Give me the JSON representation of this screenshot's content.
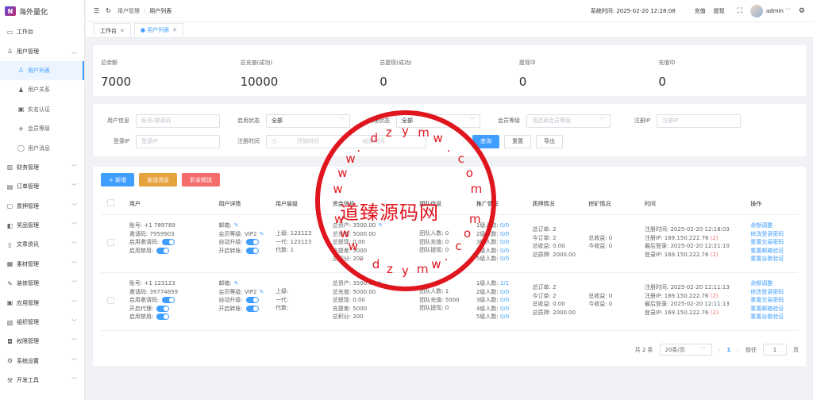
{
  "app": {
    "name": "海外量化"
  },
  "sidebar": {
    "items": [
      {
        "label": "工作台",
        "icon": "monitor-icon",
        "arrow": ""
      },
      {
        "label": "用户管理",
        "icon": "user-icon",
        "arrow": "︿"
      },
      {
        "label": "财务管理",
        "icon": "chart-icon",
        "arrow": "﹀"
      },
      {
        "label": "订单管理",
        "icon": "order-icon",
        "arrow": "﹀"
      },
      {
        "label": "质押管理",
        "icon": "wallet-icon",
        "arrow": "﹀"
      },
      {
        "label": "奖品管理",
        "icon": "gift-icon",
        "arrow": "﹀"
      },
      {
        "label": "文章资讯",
        "icon": "doc-icon",
        "arrow": "﹀"
      },
      {
        "label": "素材管理",
        "icon": "picture-icon",
        "arrow": "﹀"
      },
      {
        "label": "装修管理",
        "icon": "brush-icon",
        "arrow": "﹀"
      },
      {
        "label": "应用管理",
        "icon": "app-icon",
        "arrow": "﹀"
      },
      {
        "label": "组织管理",
        "icon": "org-icon",
        "arrow": "﹀"
      },
      {
        "label": "权限管理",
        "icon": "lock-icon",
        "arrow": "﹀"
      },
      {
        "label": "系统设置",
        "icon": "gear-icon",
        "arrow": "﹀"
      },
      {
        "label": "开发工具",
        "icon": "tool-icon",
        "arrow": "﹀"
      }
    ],
    "user_submenu": [
      {
        "label": "用户列表",
        "icon": "user-icon"
      },
      {
        "label": "用户关系",
        "icon": "users-icon"
      },
      {
        "label": "实名认证",
        "icon": "id-card-icon"
      },
      {
        "label": "会员等级",
        "icon": "rocket-icon"
      },
      {
        "label": "用户消息",
        "icon": "message-icon"
      }
    ]
  },
  "topbar": {
    "breadcrumb": [
      "用户管理",
      "用户列表"
    ],
    "system_time_label": "系统时间:",
    "system_time": "2025-02-20 12:28:08",
    "recharge": "充值",
    "withdraw": "提现",
    "user": "admin"
  },
  "tabs": [
    {
      "label": "工作台"
    },
    {
      "label": "● 用户列表"
    }
  ],
  "stats": [
    {
      "label": "总余额",
      "value": "7000"
    },
    {
      "label": "总充值(成功)",
      "value": "10000"
    },
    {
      "label": "总提现(成功)",
      "value": "0"
    },
    {
      "label": "提现中",
      "value": "0"
    },
    {
      "label": "充值中",
      "value": "0"
    }
  ],
  "filters": {
    "user_info": {
      "label": "用户信息",
      "placeholder": "账号/邀请码"
    },
    "status": {
      "label": "启用状态",
      "value": "全部"
    },
    "agent": {
      "label": "代理状态",
      "value": "全部"
    },
    "member_level": {
      "label": "会员等级",
      "placeholder": "请选择会员等级"
    },
    "reg_ip": {
      "label": "注册IP",
      "placeholder": "注册IP"
    },
    "login_ip": {
      "label": "登录IP",
      "placeholder": "登录IP"
    },
    "reg_time": {
      "label": "注册时间",
      "start": "开始时间",
      "sep": "-",
      "end": "结束时间"
    },
    "query": "查询",
    "reset": "重置",
    "export": "导出"
  },
  "actions": {
    "add": "+ 新增",
    "send": "发送消息",
    "gift": "彩金赠送"
  },
  "table": {
    "headers": [
      "用户",
      "用户详情",
      "用户层级",
      "资金信息",
      "团队信息",
      "推广情况",
      "质押情况",
      "挖矿情况",
      "时间",
      "操作"
    ],
    "rows": [
      {
        "user": [
          "账号: +1 789789",
          "邀请码: 7959903",
          "启用邀请码:",
          "启用禁用:"
        ],
        "detail": [
          "邮箱:",
          "会员等级: VIP2",
          "自动升级:",
          "开启转账:"
        ],
        "level": [
          "上级: 123123",
          "一代: 123123",
          "代数: 1"
        ],
        "funds": [
          "总资产: 3500.00",
          "总充值: 5000.00",
          "总提现: 0.00",
          "充提差: 5000",
          "总积分: 200"
        ],
        "team": [
          "团队人数: 0",
          "团队充值: 0",
          "团队提现: 0"
        ],
        "promo": [
          [
            "1级人数:",
            "0/0"
          ],
          [
            "2级人数:",
            "0/0"
          ],
          [
            "3级人数:",
            "0/0"
          ],
          [
            "4级人数:",
            "0/0"
          ],
          [
            "5级人数:",
            "0/0"
          ]
        ],
        "pledge": [
          "总订单: 2",
          "今订单: 2",
          "总收益: 0.00",
          "总质押: 2000.00"
        ],
        "mining": [
          "",
          "总收益: 0",
          "今收益: 0"
        ],
        "time": [
          [
            "注册时间: 2025-02-20 12:18:03",
            ""
          ],
          [
            "注册IP: 169.150.222.76",
            "(2)"
          ],
          [
            "最后登录: 2025-02-20 12:21:10",
            ""
          ],
          [
            "登录IP: 169.150.222.76",
            "(2)"
          ]
        ],
        "ops": [
          "余额调整",
          "修改登录密码",
          "重置交易密码",
          "重置邮箱验证",
          "重置谷歌验证"
        ]
      },
      {
        "user": [
          "账号: +1 123123",
          "邀请码: 39774859",
          "启用邀请码:",
          "开启代理:",
          "启用禁用:"
        ],
        "detail": [
          "邮箱:",
          "会员等级: VIP2",
          "自动升级:",
          "开启转账:"
        ],
        "level": [
          "上级:",
          "一代:",
          "代数:"
        ],
        "funds": [
          "总资产: 3500.00",
          "总充值: 5000.00",
          "总提现: 0.00",
          "充提差: 5000",
          "总积分: 200"
        ],
        "team": [
          "团队人数: 1",
          "团队充值: 5000",
          "团队提现: 0"
        ],
        "promo": [
          [
            "1级人数:",
            "1/1"
          ],
          [
            "2级人数:",
            "0/0"
          ],
          [
            "3级人数:",
            "0/0"
          ],
          [
            "4级人数:",
            "0/0"
          ],
          [
            "5级人数:",
            "0/0"
          ]
        ],
        "pledge": [
          "总订单: 2",
          "今订单: 2",
          "总收益: 0.00",
          "总质押: 2000.00"
        ],
        "mining": [
          "",
          "总收益: 0",
          "今收益: 0"
        ],
        "time": [
          [
            "注册时间: 2025-02-20 12:11:13",
            ""
          ],
          [
            "注册IP: 169.150.222.76",
            "(2)"
          ],
          [
            "最后登录: 2025-02-20 12:11:13",
            ""
          ],
          [
            "登录IP: 169.150.222.76",
            "(2)"
          ]
        ],
        "ops": [
          "余额调整",
          "修改登录密码",
          "重置交易密码",
          "重置邮箱验证",
          "重置谷歌验证"
        ]
      }
    ]
  },
  "pagination": {
    "total": "共 2 条",
    "page_size": "20条/页",
    "current": "1",
    "goto": "前往",
    "goto_value": "1",
    "page_unit": "页"
  },
  "watermark": {
    "text": "道臻源码网",
    "url_top": "www.dzymw.com",
    "url_bottom": "www.dzymw.com",
    "color": "#e0161f"
  }
}
